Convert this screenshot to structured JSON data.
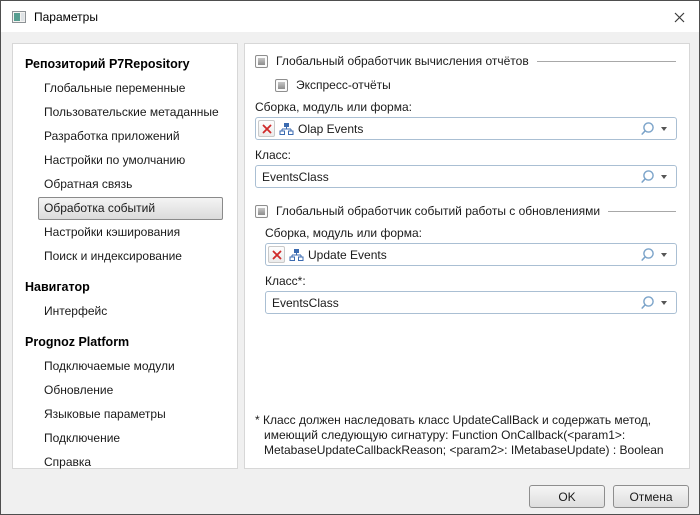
{
  "window": {
    "title": "Параметры"
  },
  "sidebar": {
    "sections": [
      {
        "header": "Репозиторий P7Repository",
        "items": [
          "Глобальные переменные",
          "Пользовательские метаданные",
          "Разработка приложений",
          "Настройки по умолчанию",
          "Обратная связь",
          "Обработка событий",
          "Настройки кэширования",
          "Поиск и индексирование"
        ],
        "selected_item": "Обработка событий"
      },
      {
        "header": "Навигатор",
        "items": [
          "Интерфейс"
        ]
      },
      {
        "header": "Prognoz Platform",
        "items": [
          "Подключаемые модули",
          "Обновление",
          "Языковые параметры",
          "Подключение",
          "Справка"
        ]
      }
    ]
  },
  "content": {
    "group1": {
      "title": "Глобальный обработчик вычисления отчётов",
      "checkbox_state": "indeterminate",
      "express_label": "Экспресс-отчёты",
      "express_checkbox_state": "indeterminate",
      "assembly_label": "Сборка, модуль или форма:",
      "assembly_value": "Olap Events",
      "class_label": "Класс:",
      "class_value": "EventsClass"
    },
    "group2": {
      "title": "Глобальный обработчик событий работы с обновлениями",
      "checkbox_state": "indeterminate",
      "assembly_label": "Сборка, модуль или форма:",
      "assembly_value": "Update Events",
      "class_label": "Класс*:",
      "class_value": "EventsClass"
    },
    "footnote": "* Класс должен наследовать класс UpdateCallBack и содержать метод, имеющий следующую сигнатуру: Function OnCallback(<param1>: MetabaseUpdateCallbackReason; <param2>: IMetabaseUpdate) : Boolean"
  },
  "buttons": {
    "ok": "OK",
    "cancel": "Отмена"
  },
  "icons": {
    "titlebar": "app-window-icon",
    "close": "close-x-icon",
    "field_left_1": "clear-red-x-icon",
    "field_left_2": "module-hierarchy-icon",
    "field_right_1": "search-magnifier-icon",
    "field_right_2": "dropdown-arrow-icon"
  },
  "colors": {
    "dialog_bg": "#f0f0f0",
    "panel_bg": "#ffffff",
    "panel_border": "#d7d7d7",
    "input_border": "#aabfd3",
    "selected_item_border": "#8a8a8a",
    "separator_line": "#a8a8a8",
    "red_x": "#cf2a2a",
    "icon_blue": "#3a6ab0",
    "magnifier_blue": "#7ba3c9"
  }
}
